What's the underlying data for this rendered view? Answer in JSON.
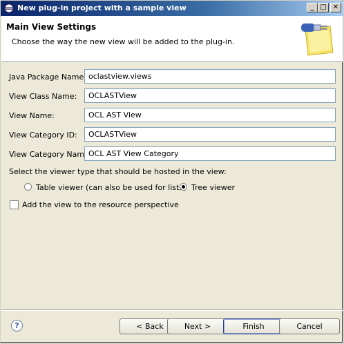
{
  "window": {
    "title": "New plug-in project with a sample view",
    "minimize_glyph": "_",
    "maximize_glyph": "□",
    "close_glyph": "✕"
  },
  "header": {
    "title": "Main View Settings",
    "description": "Choose the way the new view will be added to the plug-in."
  },
  "form": {
    "fields": [
      {
        "label": "Java Package Name:",
        "value": "oclastview.views"
      },
      {
        "label": "View Class Name:",
        "value": "OCLASTView"
      },
      {
        "label": "View Name:",
        "value": "OCL AST View"
      },
      {
        "label": "View Category ID:",
        "value": "OCLASTView"
      },
      {
        "label": "View Category Name:",
        "value": "OCL AST View Category"
      }
    ],
    "viewer_prompt": "Select the viewer type that should be hosted in the view:",
    "viewer_options": [
      {
        "label": "Table viewer (can also be used for lists)",
        "selected": false
      },
      {
        "label": "Tree viewer",
        "selected": true
      }
    ],
    "perspective_checkbox": {
      "label": "Add the view to the resource perspective",
      "checked": false
    }
  },
  "footer": {
    "help_glyph": "?",
    "back_label": "< Back",
    "next_label": "Next >",
    "finish_label": "Finish",
    "cancel_label": "Cancel"
  },
  "icons": {
    "title_icon": "eclipse-icon",
    "header_image": "plugin-wizard-icon",
    "help": "help-icon"
  },
  "colors": {
    "titlebar_start": "#0a246a",
    "titlebar_end": "#a6caf0",
    "dialog_background": "#ece9d8",
    "header_background": "#ffffff",
    "field_border": "#7f9db9"
  }
}
